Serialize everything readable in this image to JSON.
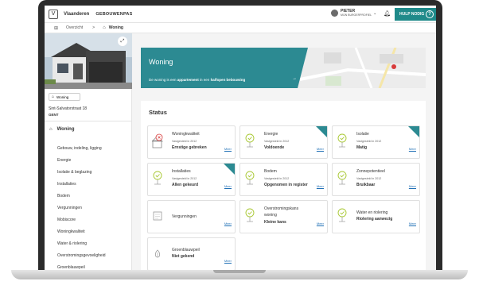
{
  "topbar": {
    "brand": "Vlaanderen",
    "app_name": "GEBOUWENPAS",
    "user_name": "PIETER",
    "user_profile": "MIJN BURGERPROFIEL",
    "help_label": "HULP NODIG",
    "help_icon": "?"
  },
  "breadcrumb": {
    "first": "Overzicht",
    "separator": ">",
    "last": "Woning"
  },
  "sidebar": {
    "tag_label": "Woning",
    "address": "Sint-Salvatorstraat 18",
    "city": "GENT",
    "nav_header": "Woning",
    "nav_items": [
      "Gebouw, indeling, ligging",
      "Energie",
      "Isolatie & beglazing",
      "Installaties",
      "Bodem",
      "Vergunningen",
      "Mobiscore",
      "Woningkwaliteit",
      "Water & riolering",
      "Overstromingsgevoeligheid",
      "Groenblauwpeil"
    ]
  },
  "hero": {
    "title": "Woning",
    "text_pre": "De woning is een ",
    "text_b1": "appartement",
    "text_mid": " in een ",
    "text_b2": "halfopen bebouwing",
    "arrow": "→"
  },
  "status": {
    "title": "Status",
    "meer_label": "Meer",
    "tiles": [
      {
        "name": "Woningkwaliteit",
        "sub": "Vastgesteld in 2012",
        "value": "Ernstige gebreken",
        "icon": "house-warning-icon",
        "corner": false
      },
      {
        "name": "Energie",
        "sub": "Vastgesteld in 2012",
        "value": "Voldoende",
        "icon": "check-pin-icon",
        "corner": true
      },
      {
        "name": "Isolatie",
        "sub": "Vastgesteld in 2012",
        "value": "Matig",
        "icon": "check-pin-icon",
        "corner": true
      },
      {
        "name": "Installaties",
        "sub": "Vastgesteld in 2012",
        "value": "Allen gekeurd",
        "icon": "check-pin-icon",
        "corner": true
      },
      {
        "name": "Bodem",
        "sub": "Vastgesteld in 2012",
        "value": "Opgenomen in register",
        "icon": "check-pin-icon",
        "corner": false
      },
      {
        "name": "Zonnepotentieel",
        "sub": "Vastgesteld in 2012",
        "value": "Bruikbaar",
        "icon": "check-pin-icon",
        "corner": false
      },
      {
        "name": "Vergunningen",
        "sub": "",
        "value": "",
        "icon": "document-icon",
        "corner": false
      },
      {
        "name": "Overstromingskans",
        "name2": "woning",
        "sub": "",
        "value": "Kleine kans",
        "icon": "check-pin-icon",
        "corner": false
      },
      {
        "name": "Water en riolering",
        "sub": "",
        "value": "Riolering aanwezig",
        "icon": "check-pin-icon",
        "corner": false
      },
      {
        "name": "Groenblauwpeil",
        "sub": "",
        "value": "Niet gekend",
        "icon": "leaf-icon",
        "corner": false
      }
    ]
  },
  "colors": {
    "teal": "#2c8a92",
    "check_green": "#a8c832",
    "alert_red": "#d83b3b"
  }
}
